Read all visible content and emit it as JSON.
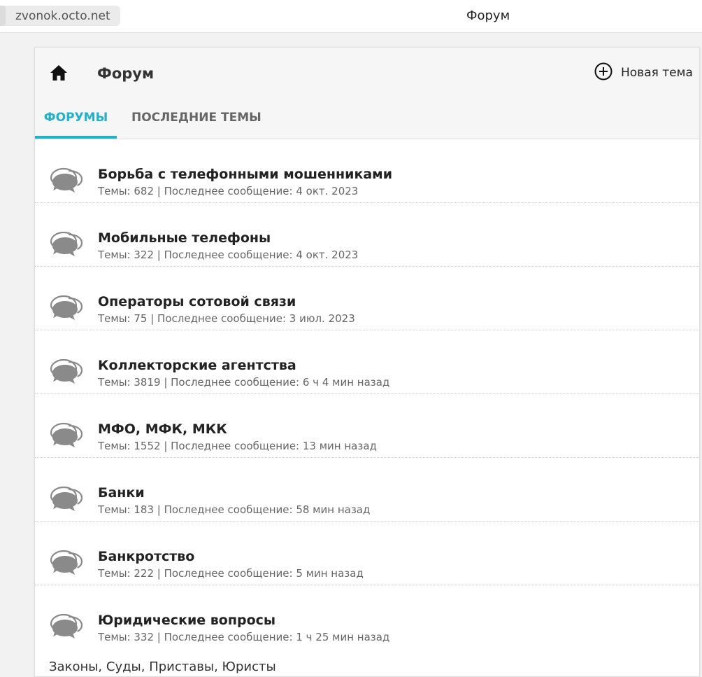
{
  "browser": {
    "url": "zvonok.octo.net",
    "title": "Форум"
  },
  "header": {
    "home_icon": "home-icon",
    "title": "Форум",
    "new_topic_icon": "plus-circle-icon",
    "new_topic_label": "Новая тема"
  },
  "tabs": [
    {
      "label": "ФОРУМЫ",
      "active": true
    },
    {
      "label": "ПОСЛЕДНИЕ ТЕМЫ",
      "active": false
    }
  ],
  "forum_icon": "chat-bubbles-icon",
  "forums": [
    {
      "title": "Борьба с телефонными мошенниками",
      "meta": "Темы: 682 | Последнее сообщение: 4 окт. 2023"
    },
    {
      "title": "Мобильные телефоны",
      "meta": "Темы: 322 | Последнее сообщение: 4 окт. 2023"
    },
    {
      "title": "Операторы сотовой связи",
      "meta": "Темы: 75 | Последнее сообщение: 3 июл. 2023"
    },
    {
      "title": "Коллекторские агентства",
      "meta": "Темы: 3819 | Последнее сообщение: 6 ч 4 мин назад"
    },
    {
      "title": "МФО, МФК, МКК",
      "meta": "Темы: 1552 | Последнее сообщение: 13 мин назад"
    },
    {
      "title": "Банки",
      "meta": "Темы: 183 | Последнее сообщение: 58 мин назад"
    },
    {
      "title": "Банкротство",
      "meta": "Темы: 222 | Последнее сообщение: 5 мин назад"
    },
    {
      "title": "Юридические вопросы",
      "meta": "Темы: 332 | Последнее сообщение: 1 ч 25 мин назад",
      "description": "Законы, Суды, Приставы, Юристы"
    }
  ],
  "colors": {
    "accent": "#20b2c8",
    "icon_gray": "#8a8a8a"
  }
}
